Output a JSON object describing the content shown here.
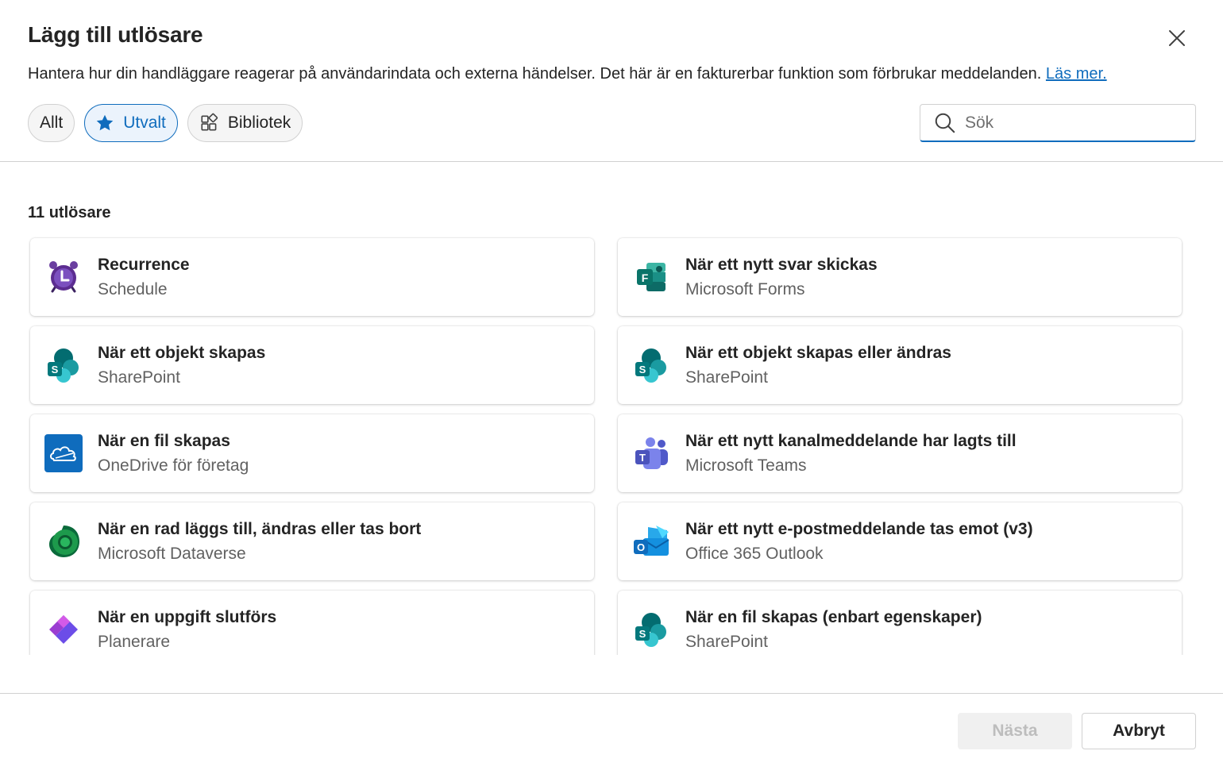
{
  "dialog": {
    "title": "Lägg till utlösare",
    "description": "Hantera hur din handläggare reagerar på användarindata och externa händelser. Det här är en fakturerbar funktion som förbrukar meddelanden.",
    "learn_more": "Läs mer."
  },
  "filters": {
    "all": "Allt",
    "featured": "Utvalt",
    "library": "Bibliotek",
    "selected": "featured"
  },
  "search": {
    "placeholder": "Sök",
    "value": ""
  },
  "count_label": "11 utlösare",
  "triggers": [
    {
      "title": "Recurrence",
      "subtitle": "Schedule",
      "icon": "clock-icon"
    },
    {
      "title": "När ett nytt svar skickas",
      "subtitle": "Microsoft Forms",
      "icon": "forms-icon"
    },
    {
      "title": "När ett objekt skapas",
      "subtitle": "SharePoint",
      "icon": "sharepoint-icon"
    },
    {
      "title": "När ett objekt skapas eller ändras",
      "subtitle": "SharePoint",
      "icon": "sharepoint-icon"
    },
    {
      "title": "När en fil skapas",
      "subtitle": "OneDrive för företag",
      "icon": "onedrive-icon"
    },
    {
      "title": "När ett nytt kanalmeddelande har lagts till",
      "subtitle": "Microsoft Teams",
      "icon": "teams-icon"
    },
    {
      "title": "När en rad läggs till, ändras eller tas bort",
      "subtitle": "Microsoft Dataverse",
      "icon": "dataverse-icon"
    },
    {
      "title": "När ett nytt e-postmeddelande tas emot (v3)",
      "subtitle": "Office 365 Outlook",
      "icon": "outlook-icon"
    },
    {
      "title": "När en uppgift slutförs",
      "subtitle": "Planerare",
      "icon": "planner-icon"
    },
    {
      "title": "När en fil skapas (enbart egenskaper)",
      "subtitle": "SharePoint",
      "icon": "sharepoint-icon"
    }
  ],
  "footer": {
    "next": "Nästa",
    "cancel": "Avbryt"
  },
  "colors": {
    "accent": "#0f6cbd",
    "selected_pill_bg": "#ebf3fc"
  }
}
